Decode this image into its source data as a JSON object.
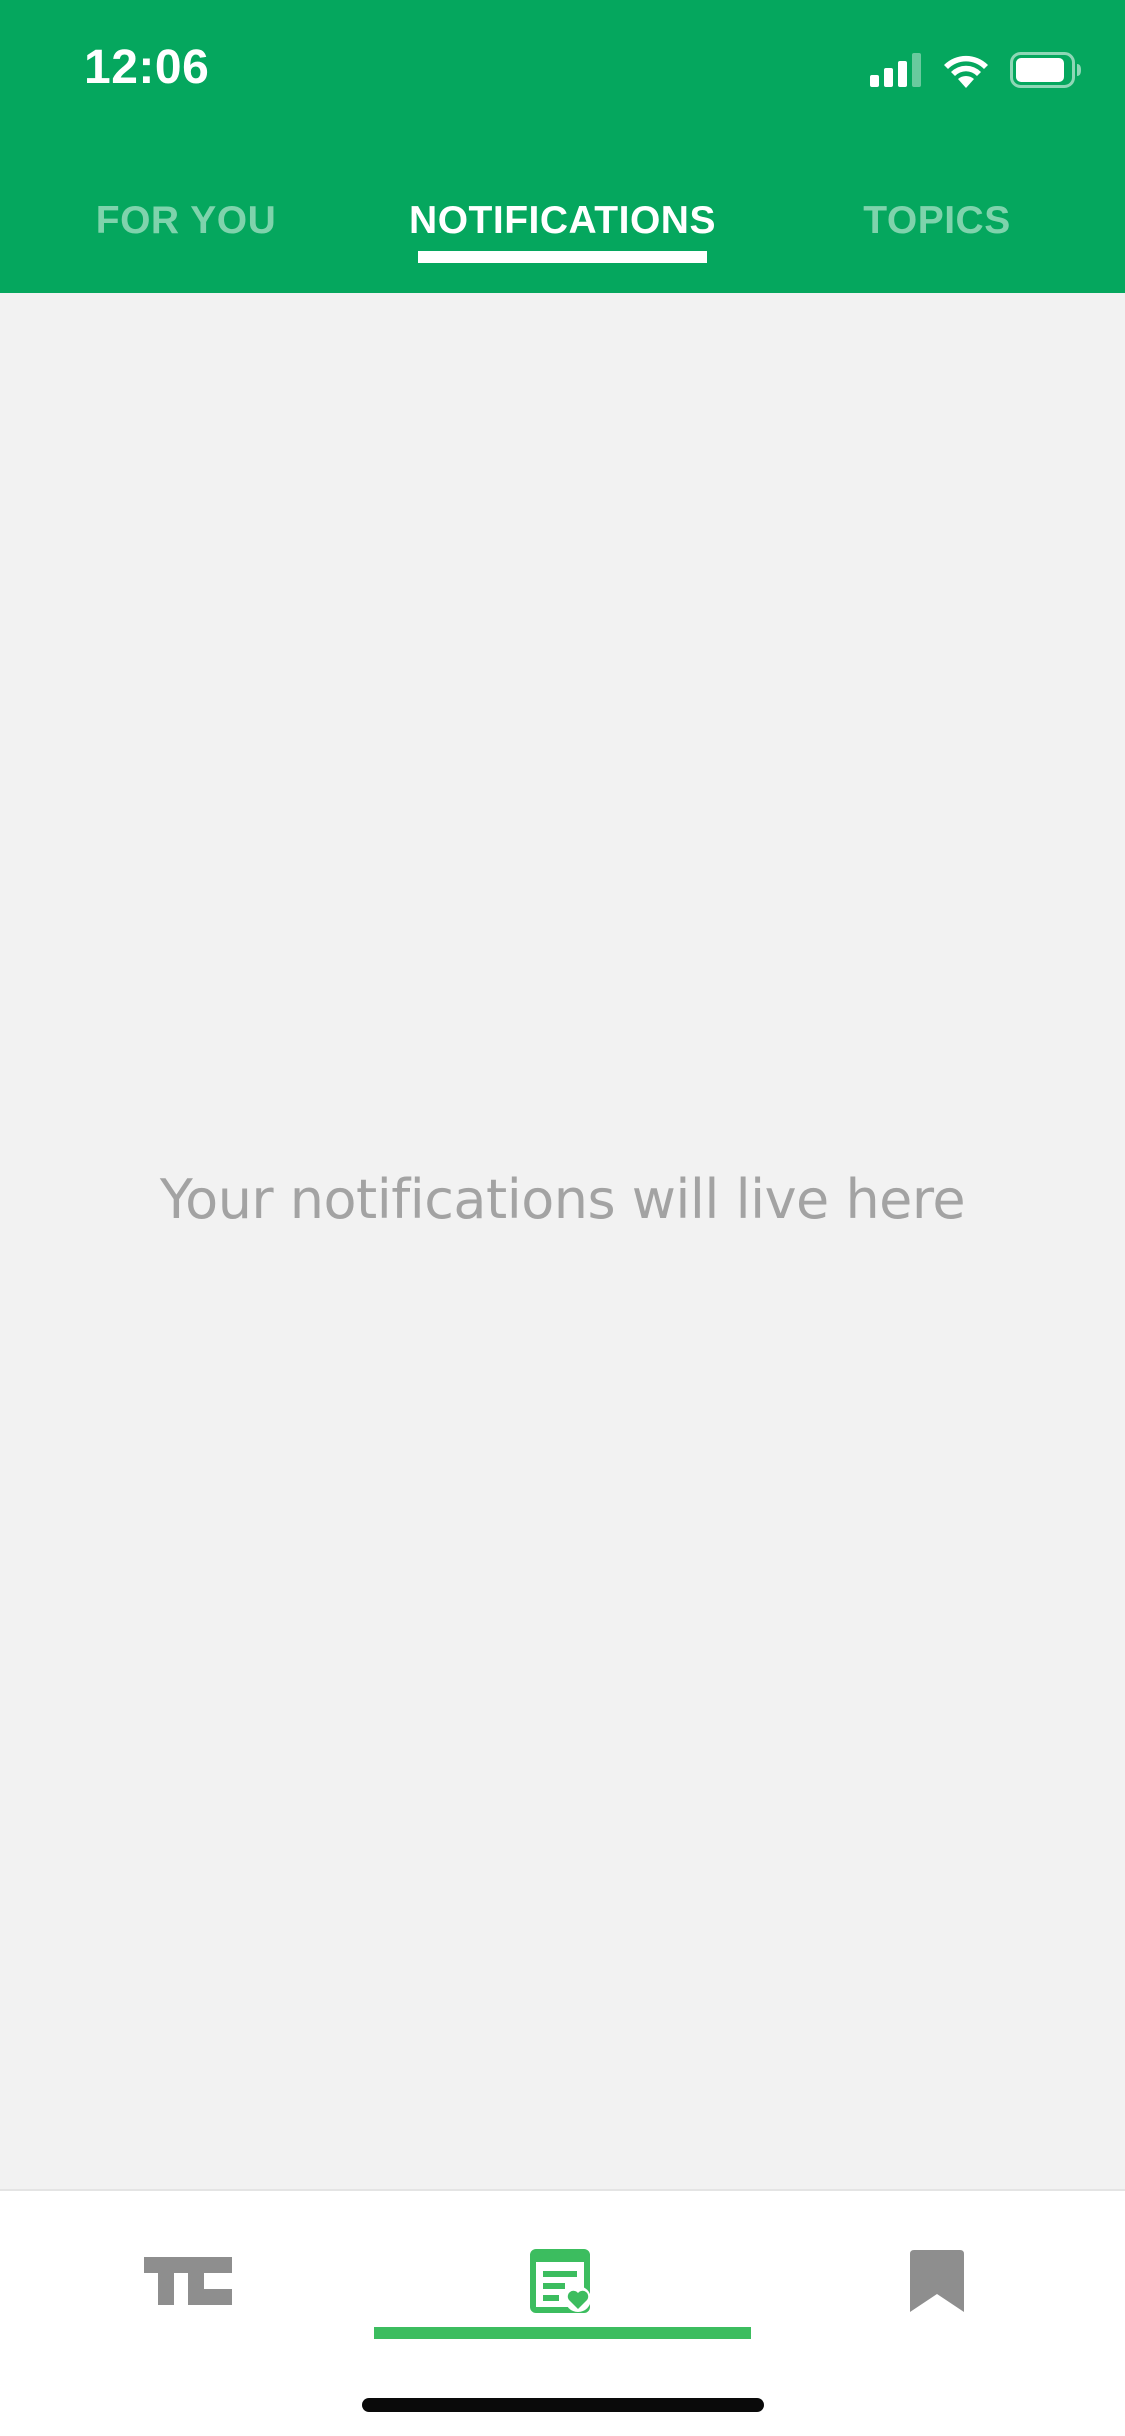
{
  "status_bar": {
    "time": "12:06"
  },
  "tabs": [
    {
      "label": "FOR YOU",
      "active": false
    },
    {
      "label": "NOTIFICATIONS",
      "active": true
    },
    {
      "label": "TOPICS",
      "active": false
    }
  ],
  "main": {
    "empty_message": "Your notifications will live here"
  },
  "bottom_nav": {
    "items": [
      {
        "icon": "techcrunch-logo-icon",
        "selected": false
      },
      {
        "icon": "notifications-feed-icon",
        "selected": true
      },
      {
        "icon": "bookmark-icon",
        "selected": false
      }
    ]
  },
  "colors": {
    "header_green": "#05a75e",
    "accent_green": "#3cbd5f",
    "inactive_tab": "#7fd3ac",
    "background": "#f2f2f2",
    "empty_text": "#a3a3a3",
    "icon_gray": "#8e8e8e"
  }
}
